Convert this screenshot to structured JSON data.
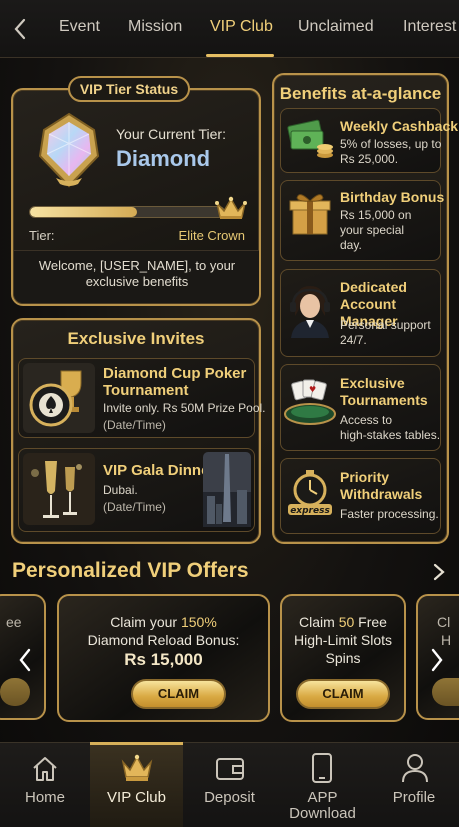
{
  "tabs": [
    {
      "label": "Event"
    },
    {
      "label": "Mission"
    },
    {
      "label": "VIP Club",
      "active": true
    },
    {
      "label": "Unclaimed"
    },
    {
      "label": "Interest"
    }
  ],
  "tier_status": {
    "header": "VIP Tier Status",
    "current_label": "Your Current Tier:",
    "current_value": "Diamond",
    "progress_fraction": 0.55,
    "left_label": "Tier:",
    "right_label": "Elite Crown",
    "welcome": "Welcome, [USER_NAME], to your exclusive benefits"
  },
  "invites": {
    "title": "Exclusive Invites",
    "items": [
      {
        "title": "Diamond Cup Poker Tournament",
        "line1": "Invite only. Rs 50M Prize Pool.",
        "line2": "(Date/Time)"
      },
      {
        "title": "VIP Gala Dinner",
        "line1": "Dubai.",
        "line2": "(Date/Time)"
      }
    ]
  },
  "benefits": {
    "title": "Benefits at-a-glance",
    "items": [
      {
        "title": "Weekly Cashback",
        "text": [
          "5% of losses, up to",
          "Rs 25,000."
        ],
        "icon": "cash-icon"
      },
      {
        "title": "Birthday Bonus",
        "text": [
          "Rs 15,000 on",
          "your special",
          "day."
        ],
        "icon": "gift-icon"
      },
      {
        "title": "Dedicated Account Manager",
        "text": [
          "Personal support",
          "24/7."
        ],
        "icon": "account-manager-icon"
      },
      {
        "title": "Exclusive Tournaments",
        "text": [
          "Access to",
          "high-stakes tables."
        ],
        "icon": "poker-table-icon"
      },
      {
        "title": "Priority Withdrawals",
        "text": [
          "Faster processing."
        ],
        "icon": "stopwatch-icon",
        "badge": "express"
      }
    ]
  },
  "offers": {
    "title": "Personalized VIP Offers",
    "left_peek": "ee",
    "right_peek": [
      "Cl",
      "H"
    ],
    "cards": [
      {
        "pre": "Claim your ",
        "highlight": "150%",
        "line2": "Diamond Reload Bonus:",
        "amount": "Rs 15,000",
        "button": "CLAIM"
      },
      {
        "pre": "Claim ",
        "highlight": "50",
        "post": " Free",
        "line2": "High-Limit Slots",
        "line3": "Spins",
        "button": "CLAIM"
      }
    ]
  },
  "nav": [
    {
      "label": "Home",
      "icon": "home-icon"
    },
    {
      "label": "VIP Club",
      "icon": "crown-icon",
      "active": true
    },
    {
      "label": "Deposit",
      "icon": "wallet-icon"
    },
    {
      "label": "APP Download",
      "icon": "phone-icon"
    },
    {
      "label": "Profile",
      "icon": "profile-icon"
    }
  ],
  "colors": {
    "accent_gold": "#f0cf7a",
    "border_gold": "#b8924a",
    "tier_blue": "#a9c8ea"
  }
}
